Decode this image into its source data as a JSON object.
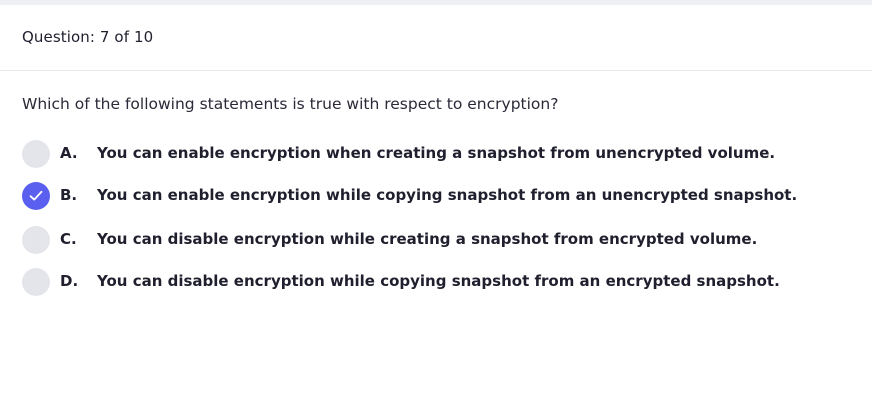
{
  "header": {
    "question_counter": "Question: 7 of 10"
  },
  "question": {
    "text": "Which of the following statements is true with respect to encryption?"
  },
  "options": [
    {
      "letter": "A.",
      "text": "You can enable encryption when creating a snapshot from unencrypted volume.",
      "selected": false
    },
    {
      "letter": "B.",
      "text": "You can enable encryption while copying snapshot from an unencrypted snapshot.",
      "selected": true
    },
    {
      "letter": "C.",
      "text": "You can disable encryption while creating a snapshot from encrypted volume.",
      "selected": false
    },
    {
      "letter": "D.",
      "text": "You can disable encryption while copying snapshot from an encrypted snapshot.",
      "selected": false
    }
  ],
  "colors": {
    "selected_accent": "#5a5ff0",
    "unselected_radio": "#e4e5ea"
  },
  "icons": {
    "selected_mark": "check-icon"
  }
}
